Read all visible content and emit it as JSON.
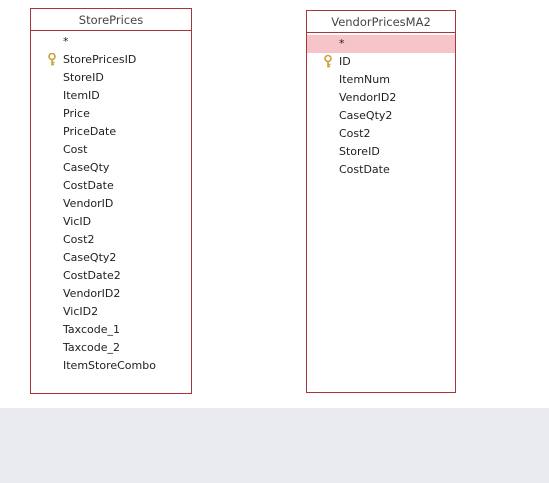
{
  "tables": [
    {
      "title": "StorePrices",
      "fields": [
        {
          "label": "*",
          "key": false
        },
        {
          "label": "StorePricesID",
          "key": true
        },
        {
          "label": "StoreID",
          "key": false
        },
        {
          "label": "ItemID",
          "key": false
        },
        {
          "label": "Price",
          "key": false
        },
        {
          "label": "PriceDate",
          "key": false
        },
        {
          "label": "Cost",
          "key": false
        },
        {
          "label": "CaseQty",
          "key": false
        },
        {
          "label": "CostDate",
          "key": false
        },
        {
          "label": "VendorID",
          "key": false
        },
        {
          "label": "VicID",
          "key": false
        },
        {
          "label": "Cost2",
          "key": false
        },
        {
          "label": "CaseQty2",
          "key": false
        },
        {
          "label": "CostDate2",
          "key": false
        },
        {
          "label": "VendorID2",
          "key": false
        },
        {
          "label": "VicID2",
          "key": false
        },
        {
          "label": "Taxcode_1",
          "key": false
        },
        {
          "label": "Taxcode_2",
          "key": false
        },
        {
          "label": "ItemStoreCombo",
          "key": false
        }
      ]
    },
    {
      "title": "VendorPricesMA2",
      "fields": [
        {
          "label": "*",
          "key": false,
          "selected": true
        },
        {
          "label": "ID",
          "key": true
        },
        {
          "label": "ItemNum",
          "key": false
        },
        {
          "label": "VendorID2",
          "key": false
        },
        {
          "label": "CaseQty2",
          "key": false
        },
        {
          "label": "Cost2",
          "key": false
        },
        {
          "label": "StoreID",
          "key": false
        },
        {
          "label": "CostDate",
          "key": false
        }
      ]
    }
  ],
  "colors": {
    "border": "#a4373a",
    "selected_row": "#f7c4ca",
    "background": "#e9ebee",
    "key_icon": "#c8a23a"
  }
}
